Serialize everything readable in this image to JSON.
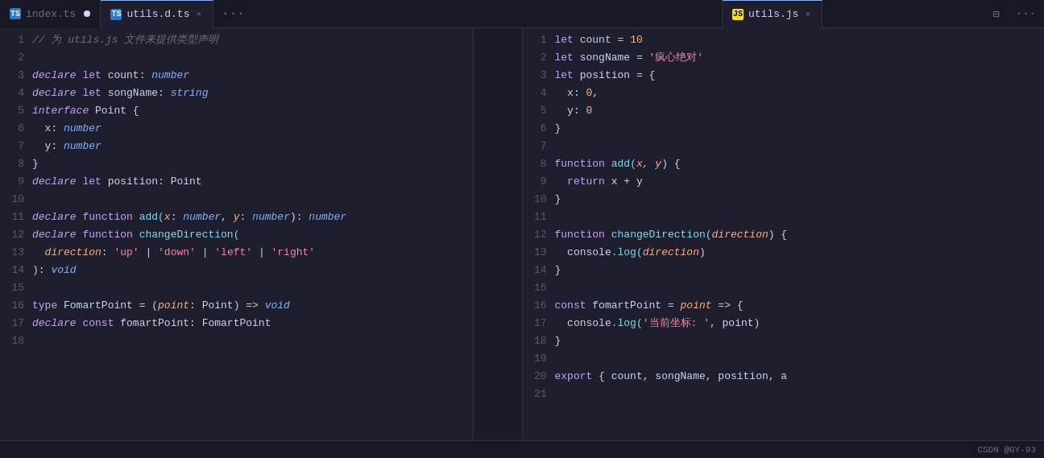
{
  "tabs": {
    "left": [
      {
        "id": "index-ts",
        "label": "index.ts",
        "icon": "ts",
        "modified": true,
        "active": false
      },
      {
        "id": "utils-dts",
        "label": "utils.d.ts",
        "icon": "ts",
        "modified": false,
        "active": true,
        "closable": true
      }
    ],
    "right": [
      {
        "id": "utils-js",
        "label": "utils.js",
        "icon": "js",
        "modified": false,
        "active": true,
        "closable": true
      }
    ]
  },
  "left_code": [
    {
      "ln": "1",
      "tokens": [
        {
          "text": "// 为 utils.js 文件来提供类型声明",
          "cls": "c-comment"
        }
      ]
    },
    {
      "ln": "2",
      "tokens": []
    },
    {
      "ln": "3",
      "tokens": [
        {
          "text": "declare",
          "cls": "c-keyword-italic"
        },
        {
          "text": " ",
          "cls": ""
        },
        {
          "text": "let",
          "cls": "c-keyword"
        },
        {
          "text": " count: ",
          "cls": "c-var"
        },
        {
          "text": "number",
          "cls": "c-type-italic"
        }
      ]
    },
    {
      "ln": "4",
      "tokens": [
        {
          "text": "declare",
          "cls": "c-keyword-italic"
        },
        {
          "text": " ",
          "cls": ""
        },
        {
          "text": "let",
          "cls": "c-keyword"
        },
        {
          "text": " songName: ",
          "cls": "c-var"
        },
        {
          "text": "string",
          "cls": "c-type-italic"
        }
      ]
    },
    {
      "ln": "5",
      "tokens": [
        {
          "text": "interface",
          "cls": "c-keyword-italic"
        },
        {
          "text": " Point {",
          "cls": "c-var"
        }
      ]
    },
    {
      "ln": "6",
      "tokens": [
        {
          "text": "  x: ",
          "cls": "c-var"
        },
        {
          "text": "number",
          "cls": "c-type-italic"
        }
      ]
    },
    {
      "ln": "7",
      "tokens": [
        {
          "text": "  y: ",
          "cls": "c-var"
        },
        {
          "text": "number",
          "cls": "c-type-italic"
        }
      ]
    },
    {
      "ln": "8",
      "tokens": [
        {
          "text": "}",
          "cls": "c-punct"
        }
      ]
    },
    {
      "ln": "9",
      "tokens": [
        {
          "text": "declare",
          "cls": "c-keyword-italic"
        },
        {
          "text": " ",
          "cls": ""
        },
        {
          "text": "let",
          "cls": "c-keyword"
        },
        {
          "text": " position: Point",
          "cls": "c-var"
        }
      ]
    },
    {
      "ln": "10",
      "tokens": []
    },
    {
      "ln": "11",
      "tokens": [
        {
          "text": "declare",
          "cls": "c-keyword-italic"
        },
        {
          "text": " ",
          "cls": ""
        },
        {
          "text": "function",
          "cls": "c-keyword"
        },
        {
          "text": " add(",
          "cls": "c-func"
        },
        {
          "text": "x",
          "cls": "c-param"
        },
        {
          "text": ": ",
          "cls": "c-var"
        },
        {
          "text": "number",
          "cls": "c-type-italic"
        },
        {
          "text": ", ",
          "cls": "c-var"
        },
        {
          "text": "y",
          "cls": "c-param"
        },
        {
          "text": ": ",
          "cls": "c-var"
        },
        {
          "text": "number",
          "cls": "c-type-italic"
        },
        {
          "text": "): ",
          "cls": "c-var"
        },
        {
          "text": "number",
          "cls": "c-type-italic"
        }
      ]
    },
    {
      "ln": "12",
      "tokens": [
        {
          "text": "declare",
          "cls": "c-keyword-italic"
        },
        {
          "text": " ",
          "cls": ""
        },
        {
          "text": "function",
          "cls": "c-keyword"
        },
        {
          "text": " changeDirection(",
          "cls": "c-func"
        }
      ]
    },
    {
      "ln": "13",
      "tokens": [
        {
          "text": "  direction",
          "cls": "c-param"
        },
        {
          "text": ": ",
          "cls": "c-var"
        },
        {
          "text": "'up'",
          "cls": "c-string2"
        },
        {
          "text": " | ",
          "cls": "c-var"
        },
        {
          "text": "'down'",
          "cls": "c-string2"
        },
        {
          "text": " | ",
          "cls": "c-var"
        },
        {
          "text": "'left'",
          "cls": "c-string2"
        },
        {
          "text": " | ",
          "cls": "c-var"
        },
        {
          "text": "'right'",
          "cls": "c-string2"
        }
      ]
    },
    {
      "ln": "14",
      "tokens": [
        {
          "text": "): ",
          "cls": "c-var"
        },
        {
          "text": "void",
          "cls": "c-type-italic"
        }
      ]
    },
    {
      "ln": "15",
      "tokens": []
    },
    {
      "ln": "16",
      "tokens": [
        {
          "text": "type",
          "cls": "c-keyword"
        },
        {
          "text": " FomartPoint = (",
          "cls": "c-var"
        },
        {
          "text": "point",
          "cls": "c-param"
        },
        {
          "text": ": Point) => ",
          "cls": "c-var"
        },
        {
          "text": "void",
          "cls": "c-type-italic"
        }
      ]
    },
    {
      "ln": "17",
      "tokens": [
        {
          "text": "declare",
          "cls": "c-keyword-italic"
        },
        {
          "text": " ",
          "cls": ""
        },
        {
          "text": "const",
          "cls": "c-keyword"
        },
        {
          "text": " fomartPoint: FomartPoint",
          "cls": "c-var"
        }
      ]
    },
    {
      "ln": "18",
      "tokens": []
    }
  ],
  "right_code": [
    {
      "ln": "1",
      "tokens": [
        {
          "text": "let",
          "cls": "c-keyword"
        },
        {
          "text": " count = ",
          "cls": "c-var"
        },
        {
          "text": "10",
          "cls": "c-number"
        }
      ]
    },
    {
      "ln": "2",
      "tokens": [
        {
          "text": "let",
          "cls": "c-keyword"
        },
        {
          "text": " songName = ",
          "cls": "c-var"
        },
        {
          "text": "'疯心绝对'",
          "cls": "c-string2"
        }
      ]
    },
    {
      "ln": "3",
      "tokens": [
        {
          "text": "let",
          "cls": "c-keyword"
        },
        {
          "text": " position = {",
          "cls": "c-var"
        }
      ]
    },
    {
      "ln": "4",
      "tokens": [
        {
          "text": "  x: ",
          "cls": "c-var"
        },
        {
          "text": "0",
          "cls": "c-number"
        },
        {
          "text": ",",
          "cls": "c-punct"
        }
      ]
    },
    {
      "ln": "5",
      "tokens": [
        {
          "text": "  y: ",
          "cls": "c-var"
        },
        {
          "text": "0",
          "cls": "c-number"
        }
      ]
    },
    {
      "ln": "6",
      "tokens": [
        {
          "text": "}",
          "cls": "c-punct"
        }
      ]
    },
    {
      "ln": "7",
      "tokens": []
    },
    {
      "ln": "8",
      "tokens": [
        {
          "text": "function",
          "cls": "c-keyword"
        },
        {
          "text": " add(",
          "cls": "c-func"
        },
        {
          "text": "x, y",
          "cls": "c-param"
        },
        {
          "text": ") {",
          "cls": "c-var"
        }
      ]
    },
    {
      "ln": "9",
      "tokens": [
        {
          "text": "  return",
          "cls": "c-keyword"
        },
        {
          "text": " x + y",
          "cls": "c-var"
        }
      ]
    },
    {
      "ln": "10",
      "tokens": [
        {
          "text": "}",
          "cls": "c-punct"
        }
      ]
    },
    {
      "ln": "11",
      "tokens": []
    },
    {
      "ln": "12",
      "tokens": [
        {
          "text": "function",
          "cls": "c-keyword"
        },
        {
          "text": " changeDirection(",
          "cls": "c-func"
        },
        {
          "text": "direction",
          "cls": "c-param"
        },
        {
          "text": ") {",
          "cls": "c-var"
        }
      ]
    },
    {
      "ln": "13",
      "tokens": [
        {
          "text": "  console",
          "cls": "c-var"
        },
        {
          "text": ".log(",
          "cls": "c-func"
        },
        {
          "text": "direction",
          "cls": "c-param"
        },
        {
          "text": ")",
          "cls": "c-punct"
        }
      ]
    },
    {
      "ln": "14",
      "tokens": [
        {
          "text": "}",
          "cls": "c-punct"
        }
      ]
    },
    {
      "ln": "15",
      "tokens": []
    },
    {
      "ln": "16",
      "tokens": [
        {
          "text": "const",
          "cls": "c-keyword"
        },
        {
          "text": " fomartPoint = ",
          "cls": "c-var"
        },
        {
          "text": "point",
          "cls": "c-param"
        },
        {
          "text": " => {",
          "cls": "c-var"
        }
      ]
    },
    {
      "ln": "17",
      "tokens": [
        {
          "text": "  console",
          "cls": "c-var"
        },
        {
          "text": ".log(",
          "cls": "c-func"
        },
        {
          "text": "'当前坐标: '",
          "cls": "c-string2"
        },
        {
          "text": ", point)",
          "cls": "c-var"
        }
      ]
    },
    {
      "ln": "18",
      "tokens": [
        {
          "text": "}",
          "cls": "c-punct"
        }
      ]
    },
    {
      "ln": "19",
      "tokens": []
    },
    {
      "ln": "20",
      "tokens": [
        {
          "text": "export",
          "cls": "c-keyword"
        },
        {
          "text": " { count, songName, position, a",
          "cls": "c-var"
        }
      ]
    },
    {
      "ln": "21",
      "tokens": []
    }
  ],
  "status_bar": {
    "credit": "CSDN @GY-93"
  },
  "icons": {
    "more": "···",
    "layout": "⊞",
    "close": "×",
    "dot": "●"
  }
}
